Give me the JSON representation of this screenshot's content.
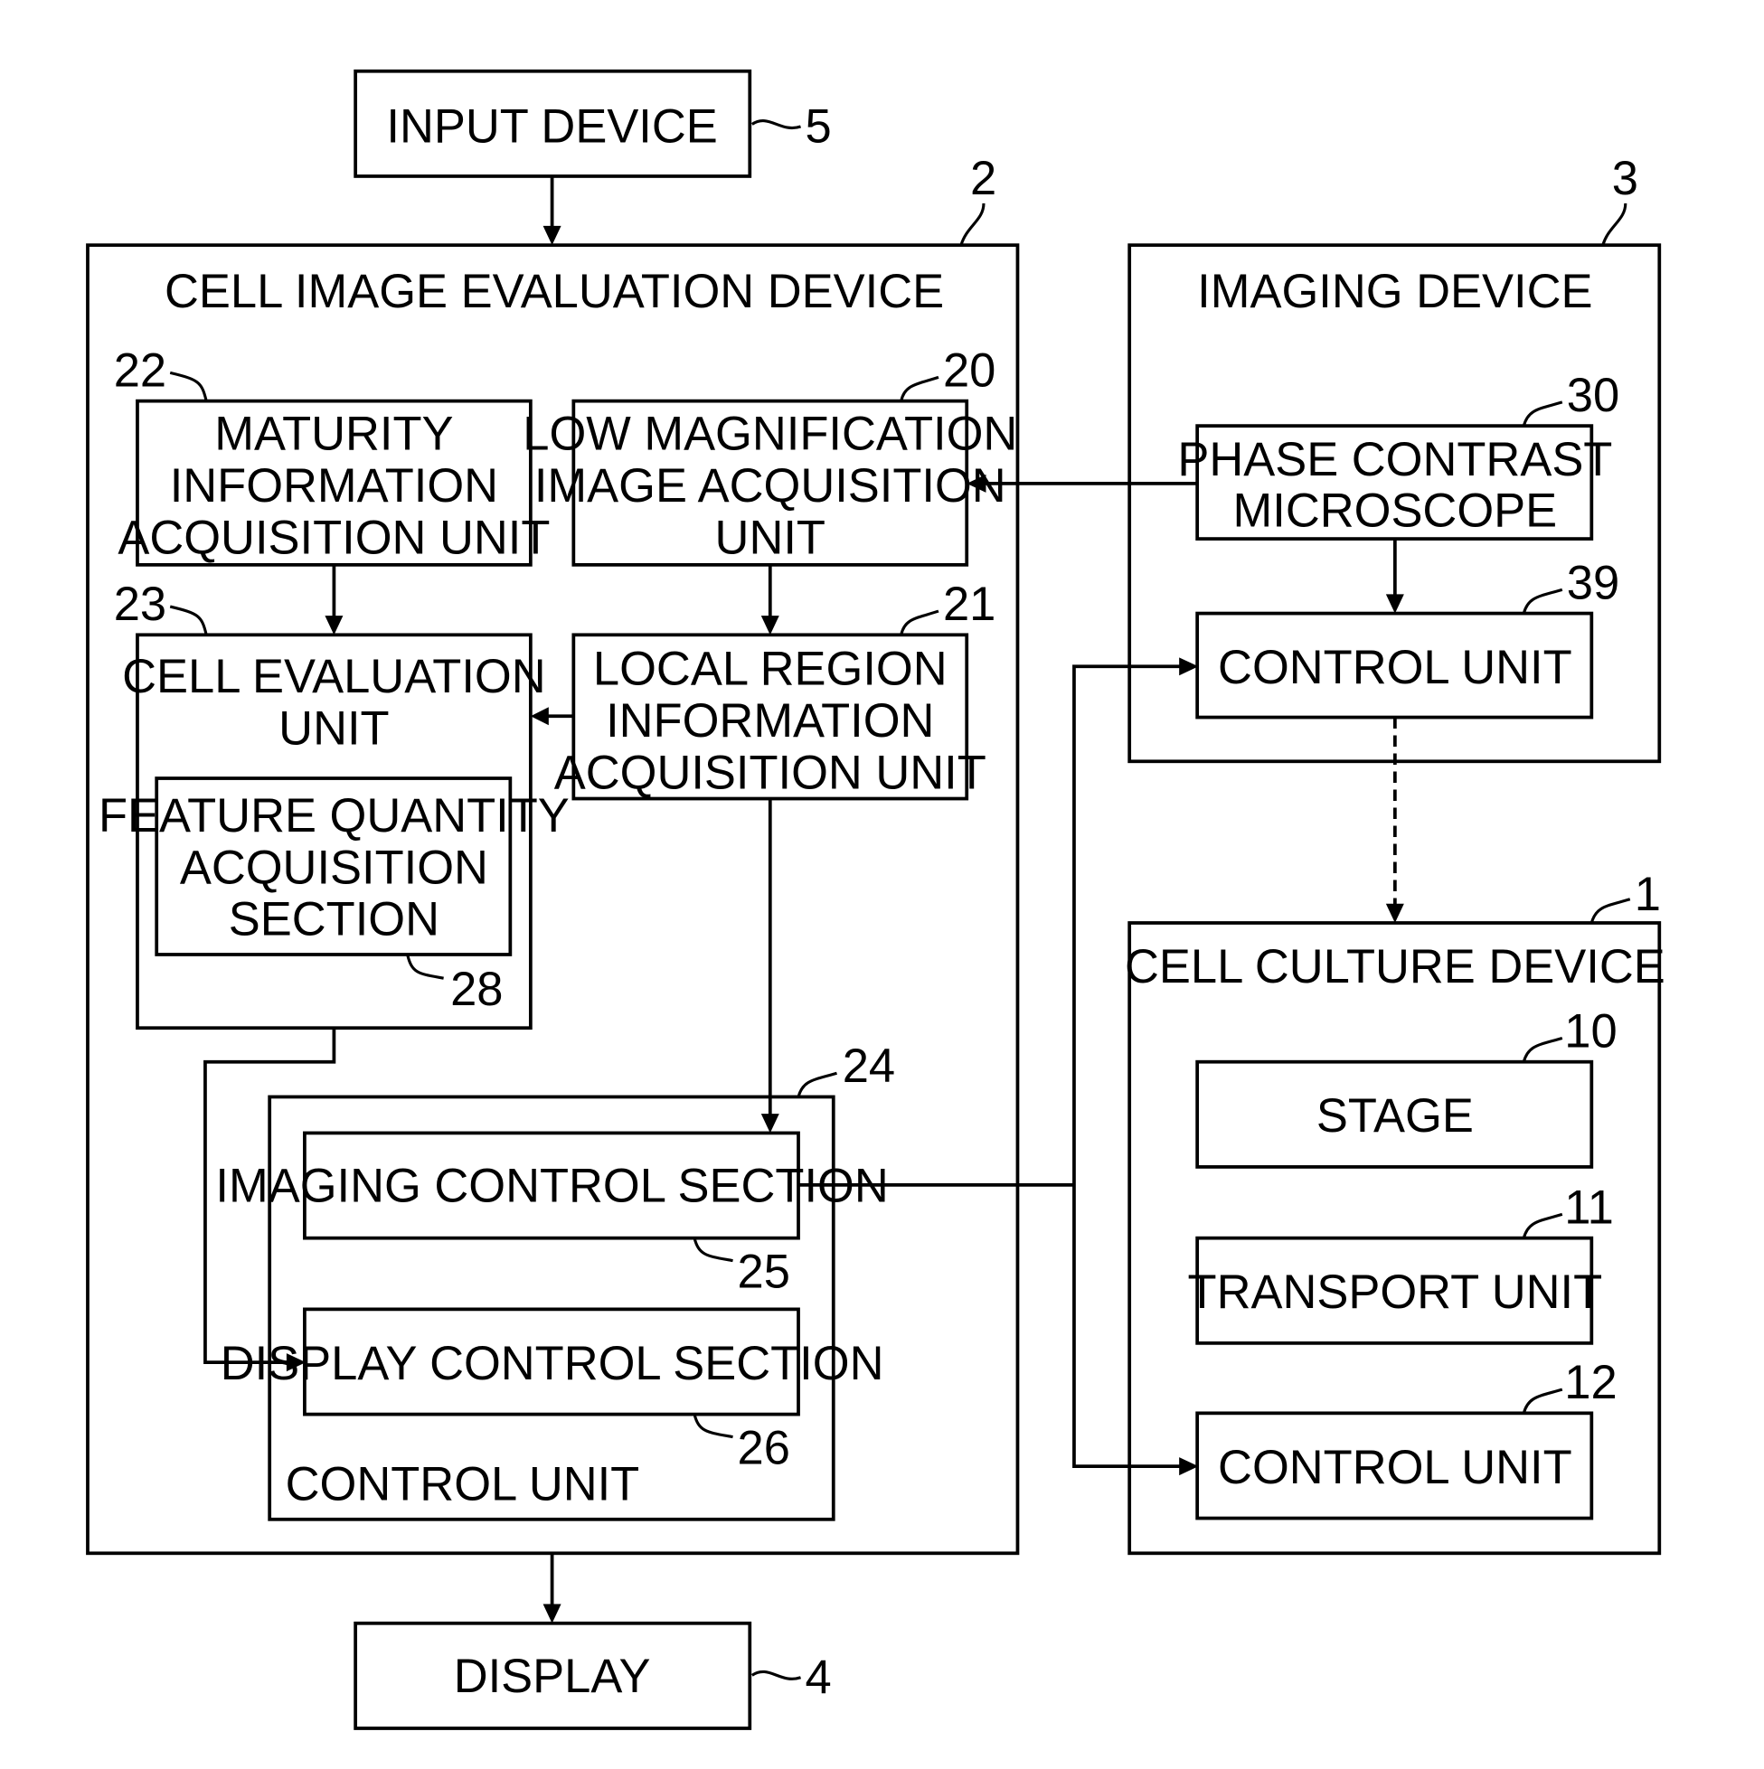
{
  "diagram": {
    "type": "block-diagram",
    "blocks": {
      "input_device": {
        "label": [
          "INPUT DEVICE"
        ],
        "ref": "5"
      },
      "cell_image_evaluation_device": {
        "label": [
          "CELL IMAGE EVALUATION DEVICE"
        ],
        "ref": "2"
      },
      "maturity_info": {
        "label": [
          "MATURITY",
          "INFORMATION",
          "ACQUISITION UNIT"
        ],
        "ref": "22"
      },
      "low_mag": {
        "label": [
          "LOW MAGNIFICATION",
          "IMAGE ACQUISITION",
          "UNIT"
        ],
        "ref": "20"
      },
      "cell_evaluation": {
        "label": [
          "CELL EVALUATION",
          "UNIT"
        ],
        "ref": "23"
      },
      "feature_quantity": {
        "label": [
          "FEATURE QUANTITY",
          "ACQUISITION",
          "SECTION"
        ],
        "ref": "28"
      },
      "local_region": {
        "label": [
          "LOCAL REGION",
          "INFORMATION",
          "ACQUISITION UNIT"
        ],
        "ref": "21"
      },
      "control_unit_24": {
        "label": [
          "CONTROL UNIT"
        ],
        "ref": "24"
      },
      "imaging_control": {
        "label": [
          "IMAGING CONTROL SECTION"
        ],
        "ref": "25"
      },
      "display_control": {
        "label": [
          "DISPLAY CONTROL SECTION"
        ],
        "ref": "26"
      },
      "imaging_device": {
        "label": [
          "IMAGING DEVICE"
        ],
        "ref": "3"
      },
      "phase_contrast": {
        "label": [
          "PHASE CONTRAST",
          "MICROSCOPE"
        ],
        "ref": "30"
      },
      "control_unit_39": {
        "label": [
          "CONTROL UNIT"
        ],
        "ref": "39"
      },
      "cell_culture_device": {
        "label": [
          "CELL CULTURE DEVICE"
        ],
        "ref": "1"
      },
      "stage": {
        "label": [
          "STAGE"
        ],
        "ref": "10"
      },
      "transport": {
        "label": [
          "TRANSPORT UNIT"
        ],
        "ref": "11"
      },
      "control_unit_12": {
        "label": [
          "CONTROL UNIT"
        ],
        "ref": "12"
      },
      "display": {
        "label": [
          "DISPLAY"
        ],
        "ref": "4"
      }
    },
    "connections": [
      {
        "from": "input_device",
        "to": "cell_image_evaluation_device",
        "style": "solid"
      },
      {
        "from": "phase_contrast",
        "to": "low_mag",
        "style": "solid"
      },
      {
        "from": "phase_contrast",
        "to": "control_unit_39",
        "style": "solid"
      },
      {
        "from": "maturity_info",
        "to": "cell_evaluation",
        "style": "solid"
      },
      {
        "from": "low_mag",
        "to": "local_region",
        "style": "solid"
      },
      {
        "from": "local_region",
        "to": "cell_evaluation",
        "style": "solid"
      },
      {
        "from": "local_region",
        "to": "imaging_control",
        "style": "solid"
      },
      {
        "from": "cell_evaluation",
        "to": "display_control",
        "style": "solid"
      },
      {
        "from": "imaging_control",
        "to": "control_unit_39",
        "style": "solid"
      },
      {
        "from": "imaging_control",
        "to": "control_unit_12",
        "style": "solid"
      },
      {
        "from": "control_unit_39",
        "to": "cell_culture_device",
        "style": "dashed"
      },
      {
        "from": "cell_image_evaluation_device",
        "to": "display",
        "style": "solid"
      }
    ]
  }
}
